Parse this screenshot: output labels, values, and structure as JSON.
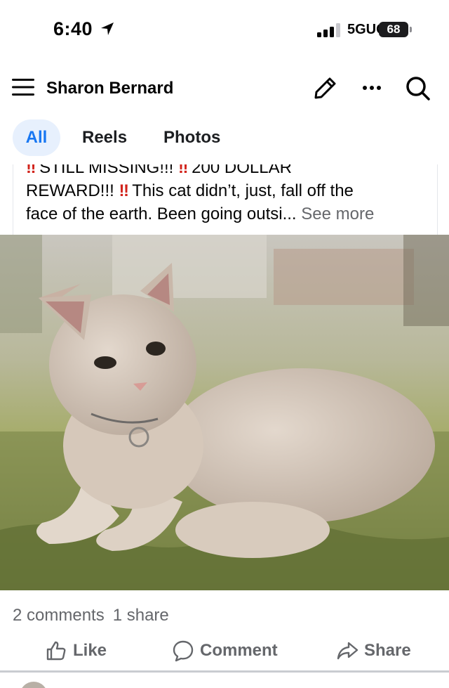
{
  "status_bar": {
    "time": "6:40",
    "network": "5GUC",
    "battery": "68"
  },
  "header": {
    "title": "Sharon Bernard",
    "icons": [
      "menu-icon",
      "edit-icon",
      "more-icon",
      "search-icon"
    ]
  },
  "tabs": [
    {
      "label": "All",
      "active": true
    },
    {
      "label": "Reels",
      "active": false
    },
    {
      "label": "Photos",
      "active": false
    }
  ],
  "post": {
    "line1": " STILL MISSING!!! ",
    "line1b": " 200 DOLLAR",
    "line2a": "REWARD!!! ",
    "line2b": " This cat didn’t, just, fall off the",
    "line3": "face of the earth. Been going outsi... ",
    "see_more": "See more",
    "bang": "‼",
    "photo_alt": "cat-photo",
    "comments": "2 comments",
    "shares": "1 share"
  },
  "actions": {
    "like": "Like",
    "comment": "Comment",
    "share": "Share"
  },
  "colors": {
    "accent": "#1877f2",
    "tab_active_bg": "#e7f0fd",
    "secondary_text": "#65676b",
    "bang_red": "#d1231b"
  }
}
